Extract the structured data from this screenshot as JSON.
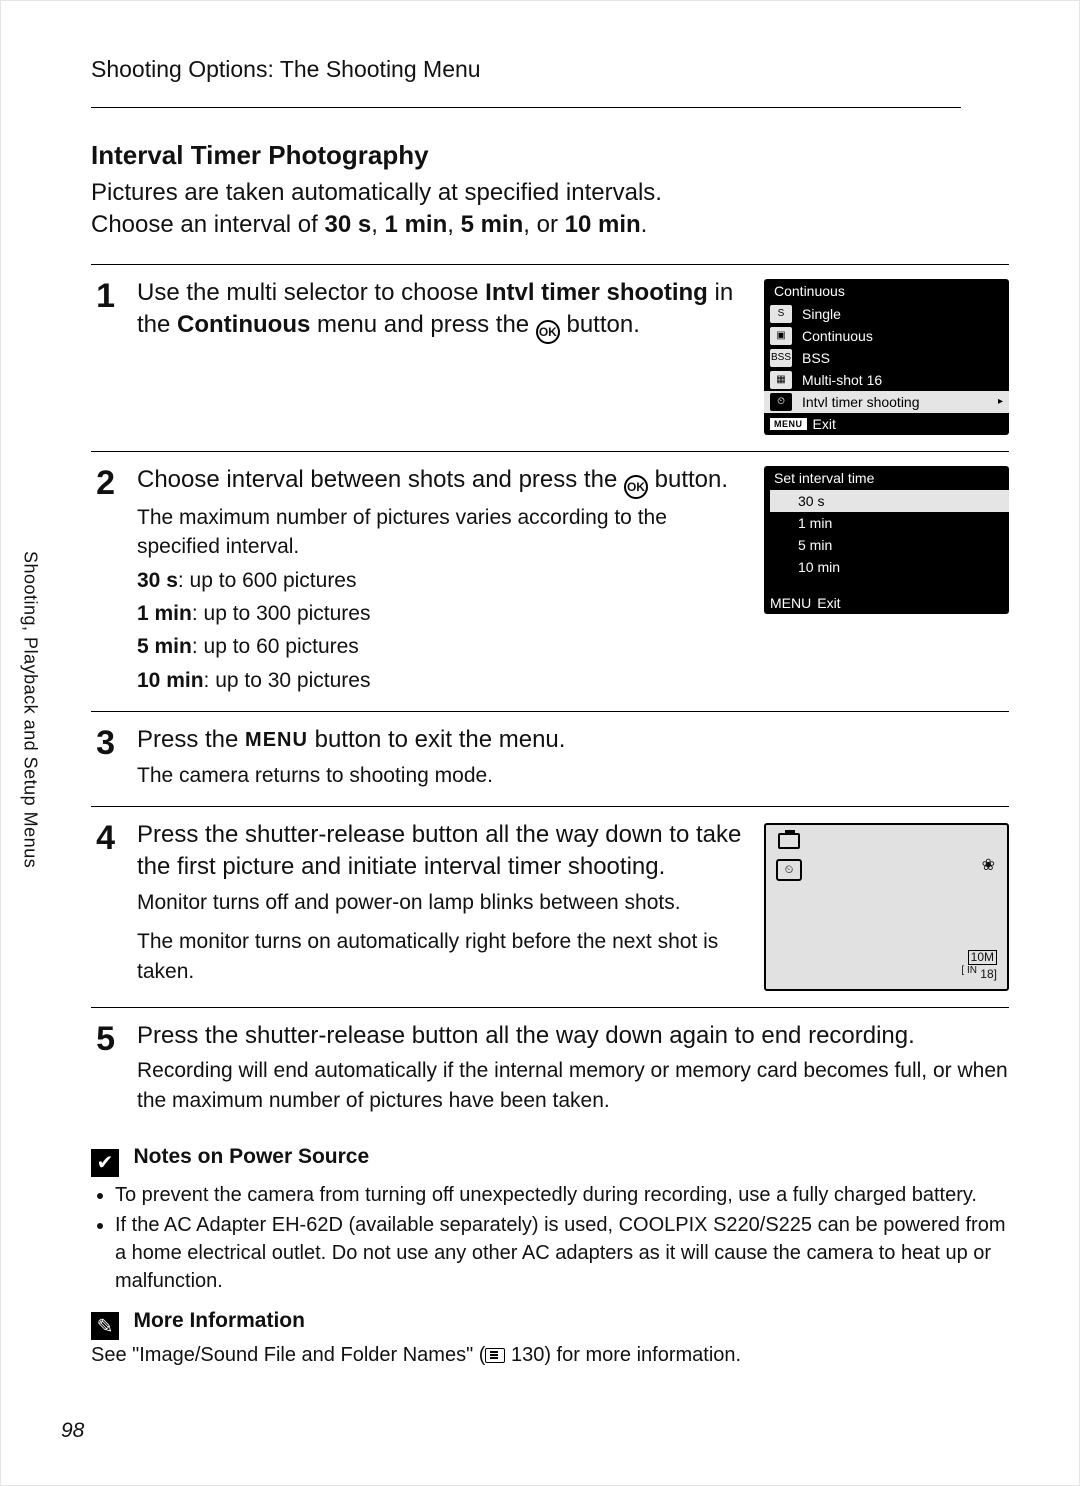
{
  "chapter": "Shooting Options: The Shooting Menu",
  "section_tab": "Shooting, Playback and Setup Menus",
  "page_number": "98",
  "heading": "Interval Timer Photography",
  "intro_line1": "Pictures are taken automatically at specified intervals.",
  "intro_line2_a": "Choose an interval of ",
  "intro_line2_b": "30 s",
  "intro_line2_c": ", ",
  "intro_line2_d": "1 min",
  "intro_line2_e": ", ",
  "intro_line2_f": "5 min",
  "intro_line2_g": ", or ",
  "intro_line2_h": "10 min",
  "intro_line2_i": ".",
  "ok_glyph": "OK",
  "step1": {
    "num": "1",
    "lead_a": "Use the multi selector to choose ",
    "lead_b": "Intvl timer shooting",
    "lead_c": " in the ",
    "lead_d": "Continuous",
    "lead_e": " menu and press the ",
    "lead_f": " button."
  },
  "screen_continuous": {
    "title": "Continuous",
    "items": [
      {
        "icon": "S",
        "label": "Single"
      },
      {
        "icon": "▣",
        "label": "Continuous"
      },
      {
        "icon": "BSS",
        "label": "BSS"
      },
      {
        "icon": "▦",
        "label": "Multi-shot 16"
      },
      {
        "icon": "⏲",
        "label": "Intvl timer shooting",
        "active": true
      }
    ],
    "menu_tag": "MENU",
    "exit": "Exit",
    "caret": "▸"
  },
  "step2": {
    "num": "2",
    "lead_a": "Choose interval between shots and press the ",
    "lead_b": " button.",
    "sub1": "The maximum number of pictures varies according to the specified interval.",
    "l1a": "30 s",
    "l1b": ": up to 600 pictures",
    "l2a": "1 min",
    "l2b": ": up to 300 pictures",
    "l3a": "5 min",
    "l3b": ": up to 60 pictures",
    "l4a": "10 min",
    "l4b": ": up to 30 pictures"
  },
  "screen_interval": {
    "title": "Set interval time",
    "options": [
      "30 s",
      "1 min",
      "5 min",
      "10 min"
    ],
    "active_index": 0,
    "menu_tag": "MENU",
    "exit": "Exit"
  },
  "step3": {
    "num": "3",
    "lead_a": "Press the ",
    "menu_label": "MENU",
    "lead_b": " button to exit the menu.",
    "sub": "The camera returns to shooting mode."
  },
  "step4": {
    "num": "4",
    "lead": "Press the shutter-release button all the way down to take the first picture and initiate interval timer shooting.",
    "sub1": "Monitor turns off and power-on lamp blinks between shots.",
    "sub2": "The monitor turns on automatically right before the next shot is taken."
  },
  "live_screen": {
    "timer_glyph": "⏲",
    "flower_glyph": "❀",
    "quality": "10M",
    "memory": "IN",
    "shots": "18"
  },
  "step5": {
    "num": "5",
    "lead": "Press the shutter-release button all the way down again to end recording.",
    "sub": "Recording will end automatically if the internal memory or memory card becomes full, or when the maximum number of pictures have been taken."
  },
  "note_power": {
    "icon": "✔",
    "title": "Notes on Power Source",
    "bullets": [
      "To prevent the camera from turning off unexpectedly during recording, use a fully charged battery.",
      "If the AC Adapter EH-62D (available separately) is used, COOLPIX S220/S225 can be powered from a home electrical outlet. Do not use any other AC adapters as it will cause the camera to heat up or malfunction."
    ]
  },
  "note_info": {
    "icon": "✎",
    "title": "More Information",
    "see_a": "See \"Image/Sound File and Folder Names\" (",
    "see_b": " 130) for more information."
  }
}
